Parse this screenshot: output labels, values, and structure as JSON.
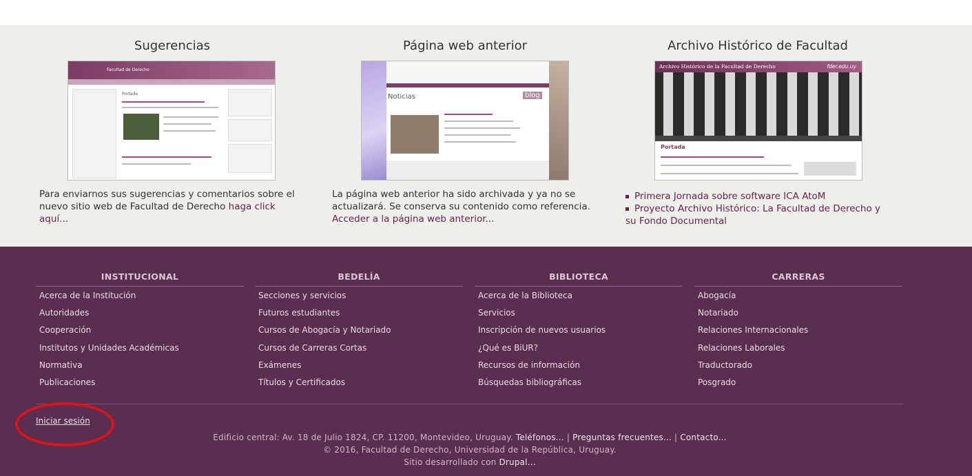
{
  "promo": {
    "col1": {
      "title": "Sugerencias",
      "desc": "Para enviarnos sus sugerencias y comentarios sobre el nuevo sitio web de Facultad de Derecho",
      "link": "haga click aquí..."
    },
    "col2": {
      "title": "Página web anterior",
      "desc": "La página web anterior ha sido archivada y ya no se actualizará. Se conserva su contenido como referencia.",
      "link": "Acceder a la página web anterior..."
    },
    "col3": {
      "title": "Archivo Histórico de Facultad",
      "links": [
        "Primera Jornada sobre software ICA AtoM",
        "Proyecto Archivo Histórico: La Facultad de Derecho y su Fondo Documental"
      ]
    }
  },
  "thumb1": {
    "site_title": "Facultad de Derecho",
    "page": "Portada"
  },
  "thumb2": {
    "heading": "Noticias",
    "badge": "blog"
  },
  "thumb3": {
    "site_title": "Archivo Histórico de la Facultad de Derecho",
    "domain": "fder.edu.uy",
    "page": "Portada"
  },
  "footer": {
    "columns": [
      {
        "title": "INSTITUCIONAL",
        "items": [
          "Acerca de la Institución",
          "Autoridades",
          "Cooperación",
          "Institutos y Unidades Académicas",
          "Normativa",
          "Publicaciones"
        ]
      },
      {
        "title": "BEDELÍA",
        "items": [
          "Secciones y servicios",
          "Futuros estudiantes",
          "Cursos de Abogacía y Notariado",
          "Cursos de Carreras Cortas",
          "Exámenes",
          "Títulos y Certificados"
        ]
      },
      {
        "title": "BIBLIOTECA",
        "items": [
          "Acerca de la Biblioteca",
          "Servicios",
          "Inscripción de nuevos usuarios",
          "¿Qué es BiUR?",
          "Recursos de información",
          "Búsquedas bibliográficas"
        ]
      },
      {
        "title": "CARRERAS",
        "items": [
          "Abogacía",
          "Notariado",
          "Relaciones Internacionales",
          "Relaciones Laborales",
          "Traductorado",
          "Posgrado"
        ]
      }
    ],
    "login": "Iniciar sesión",
    "address": "Edificio central: Av. 18 de Julio 1824, CP. 11200, Montevideo, Uruguay.",
    "links": [
      "Teléfonos...",
      "Preguntas frecuentes...",
      "Contacto..."
    ],
    "copyright": "© 2016, Facultad de Derecho, Universidad de la República, Uruguay.",
    "credit_prefix": "Sitio desarrollado con",
    "credit_link": "Drupal..."
  }
}
